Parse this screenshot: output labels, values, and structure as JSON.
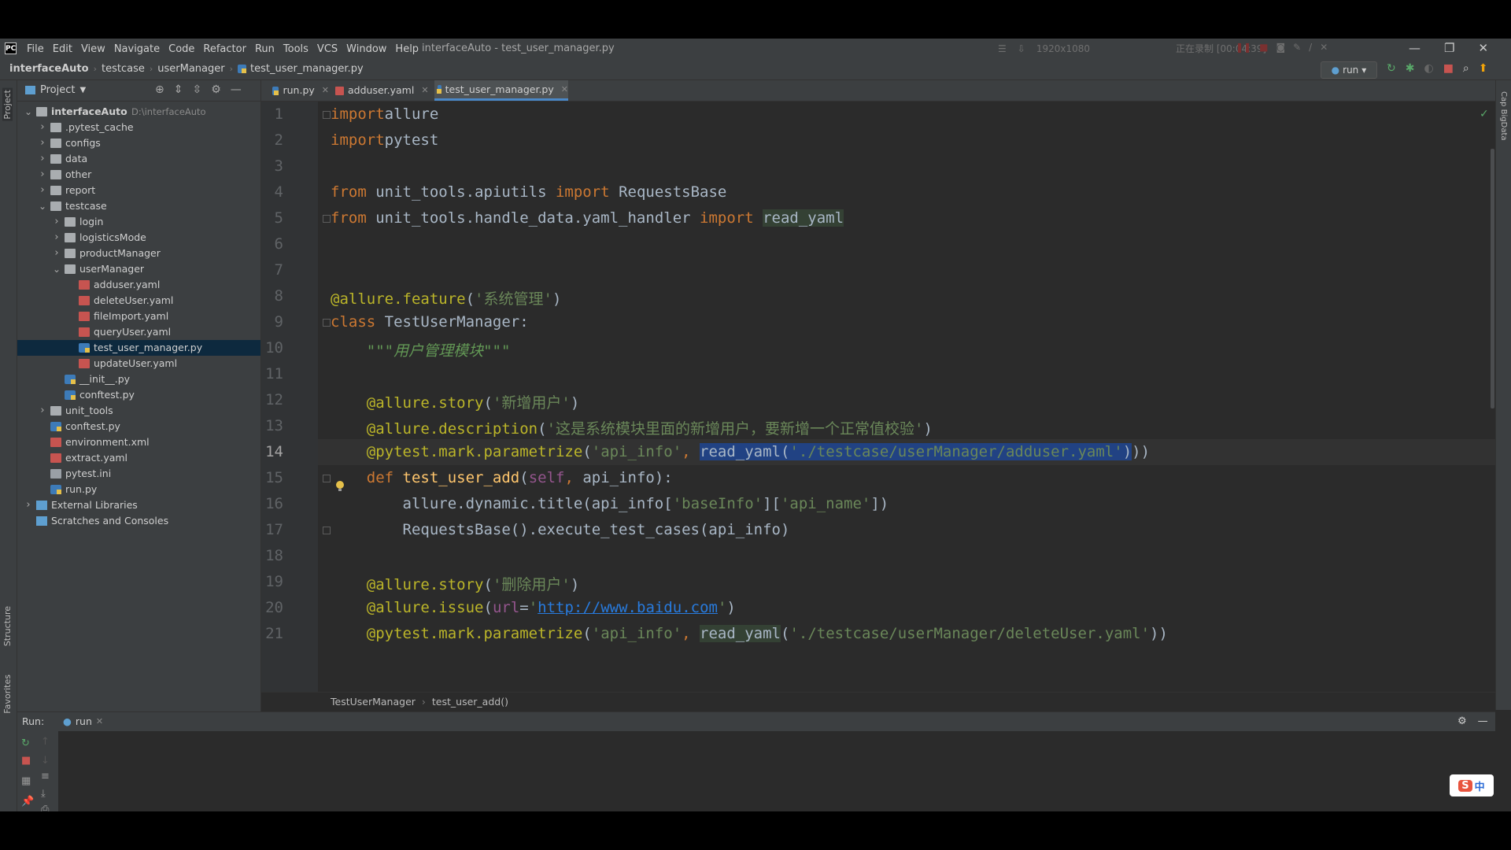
{
  "app_name": "PyCharm",
  "window_title": "interfaceAuto - test_user_manager.py",
  "menus": [
    "File",
    "Edit",
    "View",
    "Navigate",
    "Code",
    "Refactor",
    "Run",
    "Tools",
    "VCS",
    "Window",
    "Help"
  ],
  "recorder": {
    "resolution": "1920x1080",
    "status": "正在录制 [00:04:39]"
  },
  "breadcrumbs": [
    "interfaceAuto",
    "testcase",
    "userManager",
    "test_user_manager.py"
  ],
  "run_config": "run",
  "project_panel": {
    "title": "Project",
    "tree": [
      {
        "label": "interfaceAuto",
        "path": "D:\\interfaceAuto",
        "type": "folder",
        "depth": 0,
        "expanded": true,
        "bold": true
      },
      {
        "label": ".pytest_cache",
        "type": "folder",
        "depth": 1,
        "expanded": false
      },
      {
        "label": "configs",
        "type": "folder",
        "depth": 1,
        "expanded": false
      },
      {
        "label": "data",
        "type": "folder",
        "depth": 1,
        "expanded": false
      },
      {
        "label": "other",
        "type": "folder",
        "depth": 1,
        "expanded": false
      },
      {
        "label": "report",
        "type": "folder",
        "depth": 1,
        "expanded": false
      },
      {
        "label": "testcase",
        "type": "folder",
        "depth": 1,
        "expanded": true
      },
      {
        "label": "login",
        "type": "folder",
        "depth": 2,
        "expanded": false
      },
      {
        "label": "logisticsMode",
        "type": "folder",
        "depth": 2,
        "expanded": false
      },
      {
        "label": "productManager",
        "type": "folder",
        "depth": 2,
        "expanded": false
      },
      {
        "label": "userManager",
        "type": "folder",
        "depth": 2,
        "expanded": true
      },
      {
        "label": "adduser.yaml",
        "type": "yaml",
        "depth": 3
      },
      {
        "label": "deleteUser.yaml",
        "type": "yaml",
        "depth": 3
      },
      {
        "label": "fileImport.yaml",
        "type": "yaml",
        "depth": 3
      },
      {
        "label": "queryUser.yaml",
        "type": "yaml",
        "depth": 3
      },
      {
        "label": "test_user_manager.py",
        "type": "py",
        "depth": 3,
        "selected": true
      },
      {
        "label": "updateUser.yaml",
        "type": "yaml",
        "depth": 3
      },
      {
        "label": "__init__.py",
        "type": "py",
        "depth": 2
      },
      {
        "label": "conftest.py",
        "type": "py",
        "depth": 2
      },
      {
        "label": "unit_tools",
        "type": "folder",
        "depth": 1,
        "expanded": false
      },
      {
        "label": "conftest.py",
        "type": "py",
        "depth": 1
      },
      {
        "label": "environment.xml",
        "type": "yaml",
        "depth": 1
      },
      {
        "label": "extract.yaml",
        "type": "yaml",
        "depth": 1
      },
      {
        "label": "pytest.ini",
        "type": "txt",
        "depth": 1
      },
      {
        "label": "run.py",
        "type": "py",
        "depth": 1
      },
      {
        "label": "External Libraries",
        "type": "lib",
        "depth": 0,
        "expanded": false
      },
      {
        "label": "Scratches and Consoles",
        "type": "lib",
        "depth": 0
      }
    ]
  },
  "tabs": [
    {
      "label": "run.py",
      "type": "py"
    },
    {
      "label": "adduser.yaml",
      "type": "yaml"
    },
    {
      "label": "test_user_manager.py",
      "type": "py",
      "active": true
    }
  ],
  "editor": {
    "current_line": 14,
    "lines": [
      {
        "n": "1",
        "tokens": [
          [
            "kw",
            "import"
          ],
          [
            "",
            "allure"
          ]
        ]
      },
      {
        "n": "2",
        "tokens": [
          [
            "kw",
            "import"
          ],
          [
            "",
            "pytest"
          ]
        ]
      },
      {
        "n": "3",
        "tokens": []
      },
      {
        "n": "4",
        "tokens": [
          [
            "kw",
            "from"
          ],
          [
            "",
            " unit_tools.apiutils "
          ],
          [
            "kw",
            "import"
          ],
          [
            "",
            " RequestsBase"
          ]
        ]
      },
      {
        "n": "5",
        "tokens": [
          [
            "kw",
            "from"
          ],
          [
            "",
            " unit_tools.handle_data.yaml_handler "
          ],
          [
            "kw",
            "import"
          ],
          [
            "",
            " "
          ],
          [
            "hl",
            "read_yaml"
          ]
        ]
      },
      {
        "n": "6",
        "tokens": []
      },
      {
        "n": "7",
        "tokens": []
      },
      {
        "n": "8",
        "tokens": [
          [
            "dec",
            "@allure.feature"
          ],
          [
            "",
            "("
          ],
          [
            "str",
            "'系统管理'"
          ],
          [
            "",
            ")"
          ]
        ]
      },
      {
        "n": "9",
        "tokens": [
          [
            "kw",
            "class"
          ],
          [
            "",
            " TestUserManager:"
          ]
        ]
      },
      {
        "n": "10",
        "tokens": [
          [
            "",
            "    "
          ],
          [
            "doc",
            "\"\"\"用户管理模块\"\"\""
          ]
        ]
      },
      {
        "n": "11",
        "tokens": []
      },
      {
        "n": "12",
        "tokens": [
          [
            "",
            "    "
          ],
          [
            "dec",
            "@allure.story"
          ],
          [
            "",
            "("
          ],
          [
            "str",
            "'新增用户'"
          ],
          [
            "",
            ")"
          ]
        ]
      },
      {
        "n": "13",
        "tokens": [
          [
            "",
            "    "
          ],
          [
            "dec",
            "@allure.description"
          ],
          [
            "",
            "("
          ],
          [
            "str",
            "'这是系统模块里面的新增用户，要新增一个正常值校验'"
          ],
          [
            "",
            ")"
          ]
        ]
      },
      {
        "n": "14",
        "tokens": [
          [
            "",
            "    "
          ],
          [
            "dec",
            "@pytest.mark.parametrize"
          ],
          [
            "",
            "("
          ],
          [
            "str",
            "'api_info'"
          ],
          [
            "kw",
            ", "
          ],
          [
            "sel",
            "read_yaml("
          ],
          [
            "selstr",
            "'./testcase/userManager/adduser.yaml'"
          ],
          [
            "sel",
            ")"
          ],
          [
            "",
            "))"
          ]
        ]
      },
      {
        "n": "15",
        "tokens": [
          [
            "",
            "    "
          ],
          [
            "kw",
            "def "
          ],
          [
            "fn",
            "test_user_add"
          ],
          [
            "",
            "("
          ],
          [
            "slf",
            "self"
          ],
          [
            "kw",
            ", "
          ],
          [
            "",
            "api_info):"
          ]
        ]
      },
      {
        "n": "16",
        "tokens": [
          [
            "",
            "        allure.dynamic.title(api_info["
          ],
          [
            "str",
            "'baseInfo'"
          ],
          [
            "",
            "]["
          ],
          [
            "str",
            "'api_name'"
          ],
          [
            "",
            "])"
          ]
        ]
      },
      {
        "n": "17",
        "tokens": [
          [
            "",
            "        RequestsBase().execute_test_cases(api_info)"
          ]
        ]
      },
      {
        "n": "18",
        "tokens": []
      },
      {
        "n": "19",
        "tokens": [
          [
            "",
            "    "
          ],
          [
            "dec",
            "@allure.story"
          ],
          [
            "",
            "("
          ],
          [
            "str",
            "'删除用户'"
          ],
          [
            "",
            ")"
          ]
        ]
      },
      {
        "n": "20",
        "tokens": [
          [
            "",
            "    "
          ],
          [
            "dec",
            "@allure.issue"
          ],
          [
            "",
            "("
          ],
          [
            "slf",
            "url"
          ],
          [
            "",
            "="
          ],
          [
            "str",
            "'"
          ],
          [
            "lnk",
            "http://www.baidu.com"
          ],
          [
            "str",
            "'"
          ],
          [
            "",
            ")"
          ]
        ]
      },
      {
        "n": "21",
        "tokens": [
          [
            "",
            "    "
          ],
          [
            "dec",
            "@pytest.mark.parametrize"
          ],
          [
            "",
            "("
          ],
          [
            "str",
            "'api_info'"
          ],
          [
            "kw",
            ", "
          ],
          [
            "hl",
            "read_yaml"
          ],
          [
            "",
            "("
          ],
          [
            "str",
            "'./testcase/userManager/deleteUser.yaml'"
          ],
          [
            "",
            "))"
          ]
        ]
      }
    ]
  },
  "editor_breadcrumb": [
    "TestUserManager",
    "test_user_add()"
  ],
  "run_panel": {
    "label": "Run:",
    "tab": "run"
  },
  "side_labels": {
    "project": "Project",
    "structure": "Structure",
    "favorites": "Favorites",
    "right": "Cap BigData"
  },
  "ime": {
    "s": "S",
    "lang": "中"
  }
}
